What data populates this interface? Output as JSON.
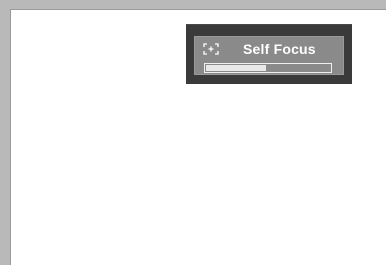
{
  "osd": {
    "title": "Self Focus",
    "icon": "focus-frame-icon",
    "progress": 0.48
  },
  "colors": {
    "panel_outer": "#3a3a3a",
    "panel_inner": "#8a8a8a",
    "text": "#ffffff",
    "progress_fill": "#e8e8e8"
  }
}
